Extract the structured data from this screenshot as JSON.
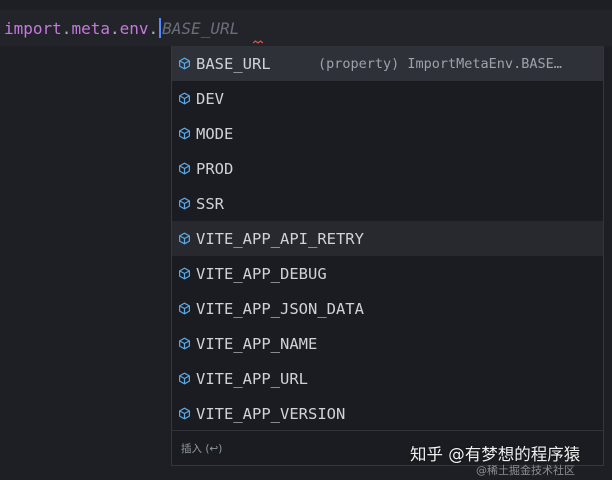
{
  "editor": {
    "code": {
      "object": "import",
      "dot1": ".",
      "meta": "meta",
      "dot2": ".",
      "env": "env",
      "dot3": ".",
      "ghost_completion": "BASE_URL"
    },
    "colors": {
      "keyword": "#c678dd",
      "ghost": "#6a6f7b",
      "caret": "#528bff",
      "error_squiggle": "#e05252"
    }
  },
  "suggest": {
    "icon": "cube-icon",
    "icon_color": "#5aa9e6",
    "selected_index": 0,
    "items": [
      {
        "label": "BASE_URL",
        "detail": "(property) ImportMetaEnv.BASE…"
      },
      {
        "label": "DEV",
        "detail": ""
      },
      {
        "label": "MODE",
        "detail": ""
      },
      {
        "label": "PROD",
        "detail": ""
      },
      {
        "label": "SSR",
        "detail": ""
      },
      {
        "label": "VITE_APP_API_RETRY",
        "detail": ""
      },
      {
        "label": "VITE_APP_DEBUG",
        "detail": ""
      },
      {
        "label": "VITE_APP_JSON_DATA",
        "detail": ""
      },
      {
        "label": "VITE_APP_NAME",
        "detail": ""
      },
      {
        "label": "VITE_APP_URL",
        "detail": ""
      },
      {
        "label": "VITE_APP_VERSION",
        "detail": ""
      }
    ],
    "footer": "插入 (↩)"
  },
  "watermark": {
    "main": "知乎 @有梦想的程序猿",
    "sub": "@稀土掘金技术社区"
  }
}
